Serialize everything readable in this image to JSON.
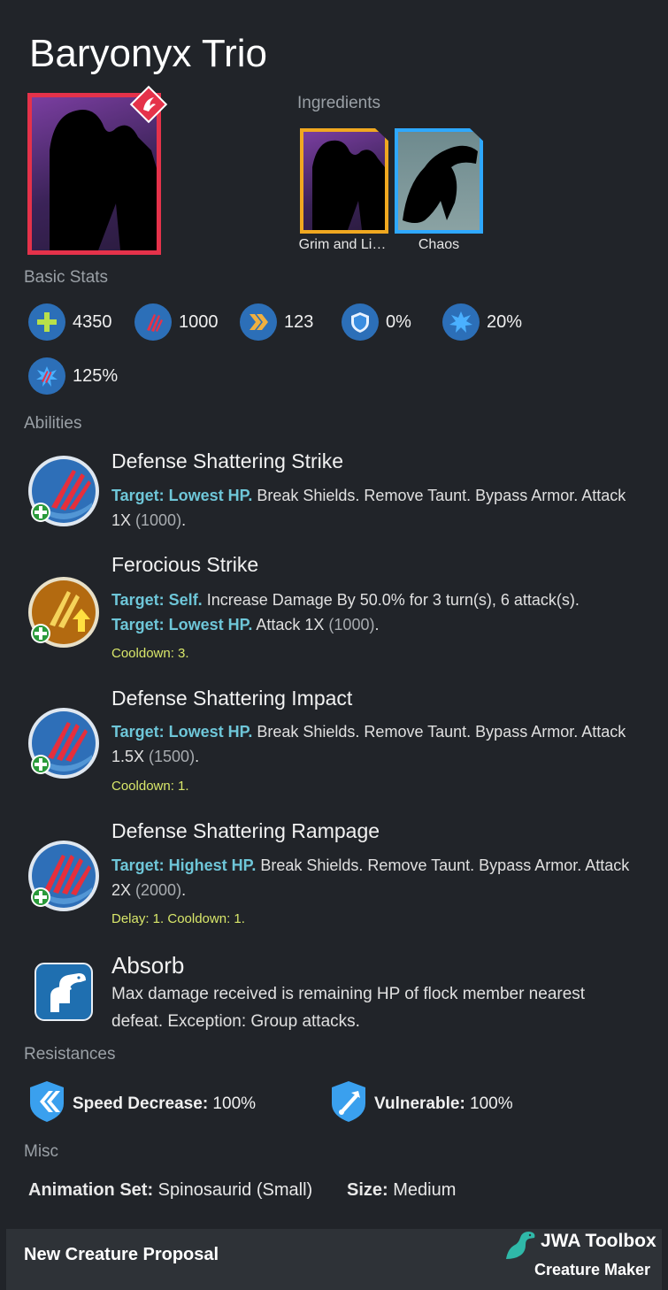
{
  "title": "Baryonyx Trio",
  "ingredients": {
    "label": "Ingredients",
    "items": [
      {
        "name": "Grim and Li…"
      },
      {
        "name": "Chaos"
      }
    ]
  },
  "basic_stats": {
    "label": "Basic Stats",
    "items": [
      {
        "icon": "health-icon",
        "value": "4350"
      },
      {
        "icon": "damage-icon",
        "value": "1000"
      },
      {
        "icon": "speed-icon",
        "value": "123"
      },
      {
        "icon": "armor-icon",
        "value": "0%"
      },
      {
        "icon": "crit-chance-icon",
        "value": "20%"
      },
      {
        "icon": "crit-multiplier-icon",
        "value": "125%"
      }
    ]
  },
  "abilities": {
    "label": "Abilities",
    "items": [
      {
        "name": "Defense Shattering Strike",
        "lines": [
          {
            "target": "Target: Lowest HP.",
            "text": " Break Shields. Remove Taunt. Bypass Armor. Attack",
            "cont": "1X ",
            "paren": "(1000)",
            "end": "."
          }
        ],
        "cooldown": ""
      },
      {
        "name": "Ferocious Strike",
        "line1_target": "Target: Self.",
        "line1_text": " Increase Damage By 50.0% for 3 turn(s), 6 attack(s).",
        "line2_target": "Target: Lowest HP.",
        "line2_text": " Attack 1X ",
        "line2_paren": "(1000)",
        "line2_end": ".",
        "cooldown": "Cooldown: 3."
      },
      {
        "name": "Defense Shattering Impact",
        "target": "Target: Lowest HP.",
        "text": " Break Shields. Remove Taunt. Bypass Armor. Attack",
        "cont": "1.5X ",
        "paren": "(1500)",
        "end": ".",
        "cooldown": "Cooldown: 1."
      },
      {
        "name": "Defense Shattering Rampage",
        "target": "Target: Highest HP.",
        "text": " Break Shields. Remove Taunt. Bypass Armor. Attack",
        "cont": "2X ",
        "paren": "(2000)",
        "end": ".",
        "cooldown": "Delay: 1. Cooldown: 1."
      },
      {
        "name": "Absorb",
        "text1": "Max damage received is remaining HP of flock member nearest",
        "text2": "defeat. Exception: Group attacks."
      }
    ]
  },
  "resistances": {
    "label": "Resistances",
    "items": [
      {
        "name": "Speed Decrease:",
        "value": " 100%"
      },
      {
        "name": "Vulnerable:",
        "value": " 100%"
      }
    ]
  },
  "misc": {
    "label": "Misc",
    "animation_label": "Animation Set:",
    "animation_value": " Spinosaurid (Small)",
    "size_label": "Size:",
    "size_value": " Medium"
  },
  "footer": {
    "left": "New Creature Proposal",
    "brand": "JWA Toolbox",
    "sub": "Creature Maker"
  },
  "colors": {
    "background": "#212429",
    "unique_border": "#e5324a",
    "legendary_border": "#f0a820",
    "epic_border": "#2ea8ff",
    "target_text": "#6ec6d8",
    "cooldown_text": "#d9e76a"
  }
}
